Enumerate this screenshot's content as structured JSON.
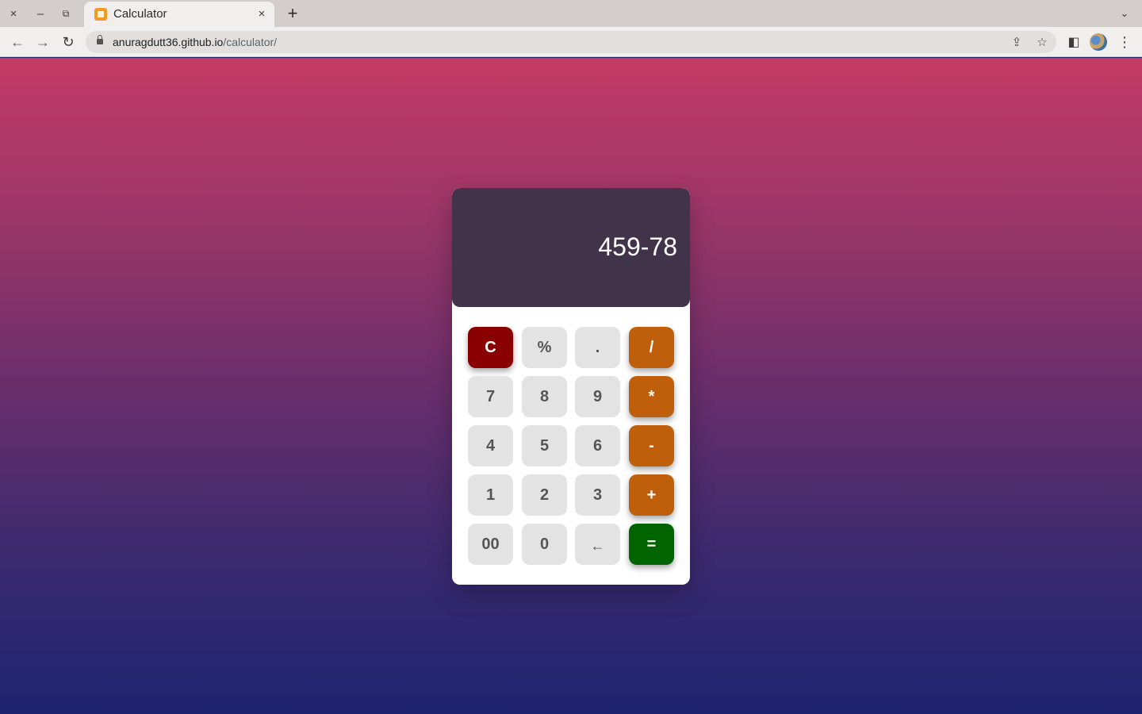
{
  "browser": {
    "tab_title": "Calculator",
    "url_host": "anuragdutt36.github.io",
    "url_path": "/calculator/",
    "icons": {
      "close_window": "×",
      "minimize": "–",
      "restore": "⧉",
      "tab_close": "×",
      "new_tab": "+",
      "tab_list": "⌄",
      "back": "←",
      "forward": "→",
      "reload": "↻",
      "share": "⇪",
      "bookmark": "☆",
      "side_panel": "◧",
      "menu": "⋮"
    }
  },
  "calculator": {
    "display": "459-78",
    "keys": [
      {
        "label": "C",
        "type": "clear"
      },
      {
        "label": "%",
        "type": "digit"
      },
      {
        "label": ".",
        "type": "digit"
      },
      {
        "label": "/",
        "type": "op"
      },
      {
        "label": "7",
        "type": "digit"
      },
      {
        "label": "8",
        "type": "digit"
      },
      {
        "label": "9",
        "type": "digit"
      },
      {
        "label": "*",
        "type": "op"
      },
      {
        "label": "4",
        "type": "digit"
      },
      {
        "label": "5",
        "type": "digit"
      },
      {
        "label": "6",
        "type": "digit"
      },
      {
        "label": "-",
        "type": "op"
      },
      {
        "label": "1",
        "type": "digit"
      },
      {
        "label": "2",
        "type": "digit"
      },
      {
        "label": "3",
        "type": "digit"
      },
      {
        "label": "+",
        "type": "op"
      },
      {
        "label": "00",
        "type": "digit"
      },
      {
        "label": "0",
        "type": "digit"
      },
      {
        "label": "←",
        "type": "back"
      },
      {
        "label": "=",
        "type": "equals"
      }
    ]
  },
  "colors": {
    "background_top": "#c43a65",
    "background_bottom": "#1e2470",
    "display_bg": "#41344a",
    "operator": "#bf5e0b",
    "clear": "#8a0000",
    "equals": "#006400",
    "digit": "#e3e3e3"
  }
}
